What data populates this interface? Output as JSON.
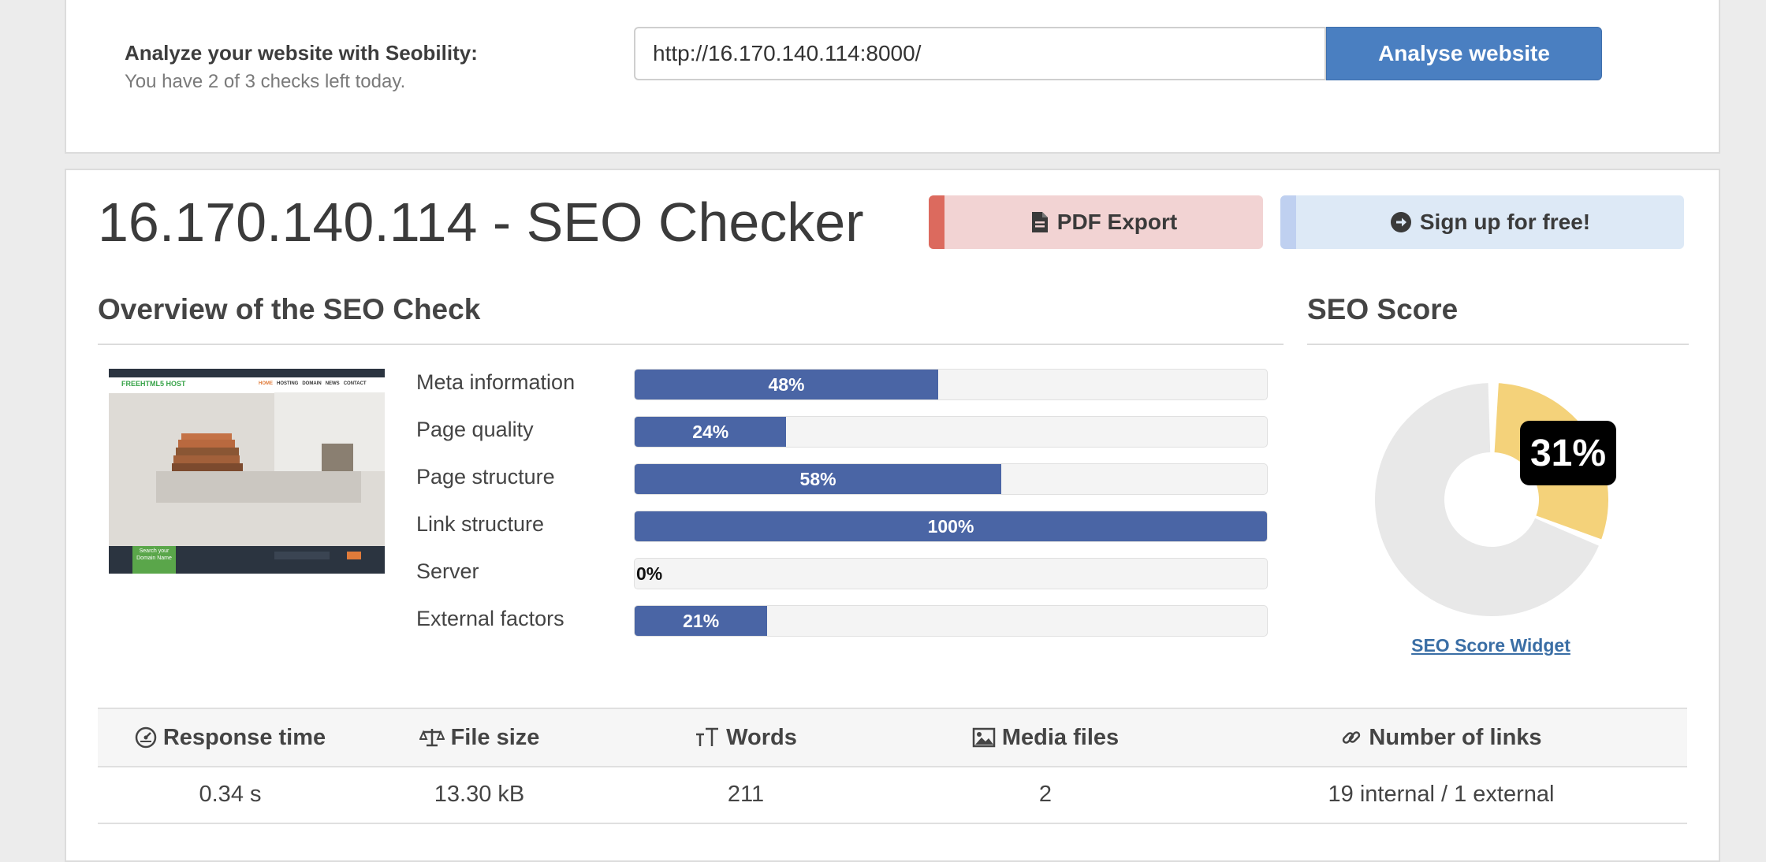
{
  "analyze": {
    "title": "Analyze your website with Seobility:",
    "subtitle": "You have 2 of 3 checks left today.",
    "url_value": "http://16.170.140.114:8000/",
    "button_label": "Analyse website"
  },
  "header": {
    "title": "16.170.140.114 - SEO Checker",
    "pdf_label": "PDF Export",
    "signup_label": "Sign up for free!"
  },
  "overview": {
    "heading": "Overview of the SEO Check",
    "metrics": [
      {
        "label": "Meta information",
        "value": 48,
        "display": "48%"
      },
      {
        "label": "Page quality",
        "value": 24,
        "display": "24%"
      },
      {
        "label": "Page structure",
        "value": 58,
        "display": "58%"
      },
      {
        "label": "Link structure",
        "value": 100,
        "display": "100%"
      },
      {
        "label": "Server",
        "value": 0,
        "display": "0%"
      },
      {
        "label": "External factors",
        "value": 21,
        "display": "21%"
      }
    ]
  },
  "score": {
    "heading": "SEO Score",
    "value": 31,
    "display": "31%",
    "widget_link": "SEO Score Widget",
    "colors": {
      "filled": "#f4d27a",
      "empty": "#e8e8e8"
    }
  },
  "stats": {
    "headers": [
      {
        "label": "Response time",
        "icon": "dashboard-icon"
      },
      {
        "label": "File size",
        "icon": "scale-icon"
      },
      {
        "label": "Words",
        "icon": "text-size-icon"
      },
      {
        "label": "Media files",
        "icon": "image-icon"
      },
      {
        "label": "Number of links",
        "icon": "link-icon"
      }
    ],
    "values": [
      "0.34 s",
      "13.30 kB",
      "211",
      "2",
      "19 internal / 1 external"
    ]
  },
  "thumbnail": {
    "brand": "FREEHTML5 HOST",
    "nav": [
      "HOME",
      "HOSTING",
      "DOMAIN",
      "NEWS",
      "CONTACT"
    ],
    "cta": "Search your Domain Name"
  },
  "colors": {
    "bar": "#4a65a5",
    "primary_button": "#4a7fc1",
    "pdf_accent": "#dc6a5e"
  }
}
